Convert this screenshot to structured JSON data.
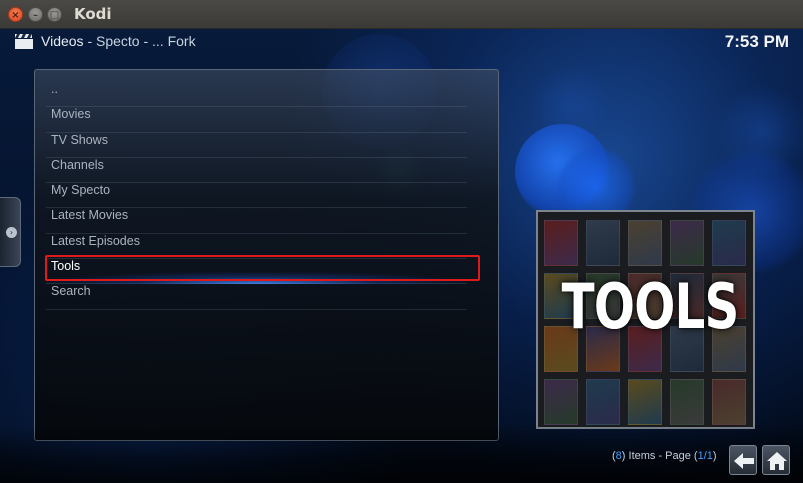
{
  "window": {
    "title": "Kodi",
    "controls": {
      "close": "×",
      "minimize": "–",
      "maximize": "□"
    }
  },
  "header": {
    "section": "Videos",
    "path": "- Specto - ... Fork",
    "clock": "7:53 PM",
    "icon": "clapperboard-icon"
  },
  "list": {
    "items": [
      {
        "label": ".."
      },
      {
        "label": "Movies"
      },
      {
        "label": "TV Shows"
      },
      {
        "label": "Channels"
      },
      {
        "label": "My Specto"
      },
      {
        "label": "Latest Movies"
      },
      {
        "label": "Latest Episodes"
      },
      {
        "label": "Tools"
      },
      {
        "label": "Search"
      }
    ],
    "selected_label": "Tools"
  },
  "poster": {
    "text": "TOOLS"
  },
  "footer": {
    "open_paren": "(",
    "item_count": "8",
    "items_text": ") Items - Page (",
    "page": "1/1",
    "close_paren": ")"
  },
  "colors": {
    "accent": "#3fa0ff",
    "selection_border": "#e01a1a",
    "background": "#04122b"
  }
}
